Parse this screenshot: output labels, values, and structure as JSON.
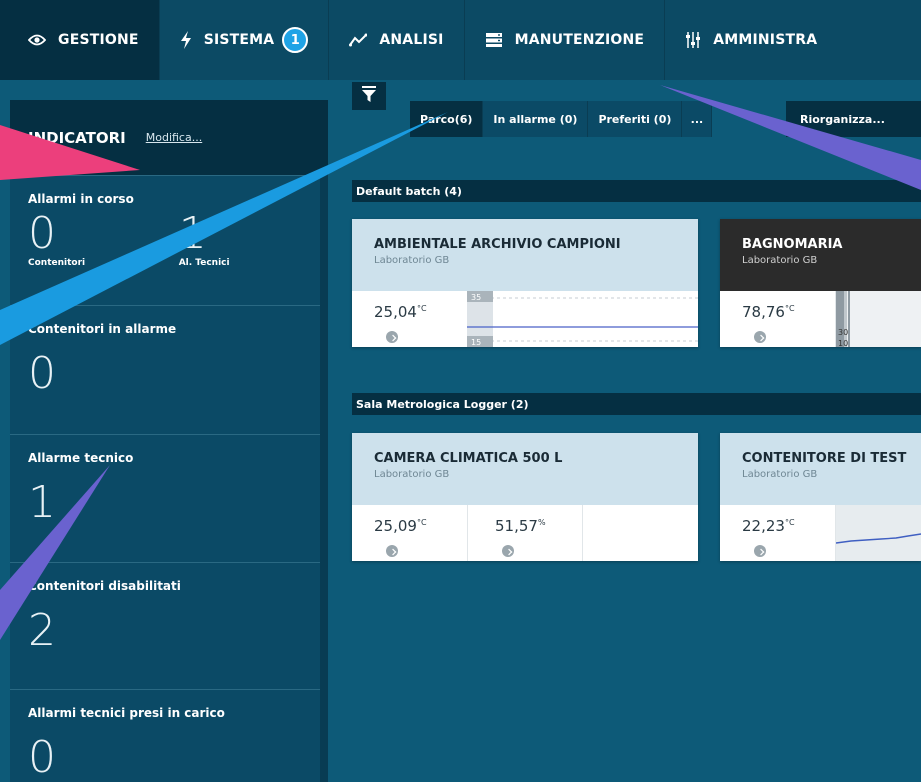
{
  "nav": {
    "items": [
      {
        "label": "GESTIONE",
        "icon": "eye-icon"
      },
      {
        "label": "SISTEMA",
        "icon": "lightning-icon",
        "badge": "1"
      },
      {
        "label": "ANALISI",
        "icon": "trend-line-icon"
      },
      {
        "label": "MANUTENZIONE",
        "icon": "server-icon"
      },
      {
        "label": "AMMINISTRA",
        "icon": "sliders-icon"
      }
    ]
  },
  "sidebar": {
    "title": "INDICATORI",
    "edit_link": "Modifica...",
    "indicators": [
      {
        "label": "Allarmi in corso",
        "values": [
          {
            "value": "0",
            "sub": "Contenitori"
          },
          {
            "value": "1",
            "sub": "Al. Tecnici"
          }
        ]
      },
      {
        "label": "Contenitori in allarme",
        "value": "0"
      },
      {
        "label": "Allarme tecnico",
        "value": "1"
      },
      {
        "label": "Contenitori disabilitati",
        "value": "2"
      },
      {
        "label": "Allarmi tecnici presi in carico",
        "value": "0"
      }
    ]
  },
  "toolbar": {
    "filter_icon": "funnel-icon",
    "tabs": [
      "Parco(6)",
      "In allarme (0)",
      "Preferiti (0)",
      "..."
    ],
    "reorganize": "Riorganizza..."
  },
  "batches": [
    {
      "name": "Default batch (4)",
      "cards": [
        {
          "title": "AMBIENTALE ARCHIVIO CAMPIONI",
          "subtitle": "Laboratorio GB",
          "readings": [
            {
              "value": "25,04",
              "unit": "°C"
            }
          ],
          "chart_max": "35",
          "chart_min": "15"
        },
        {
          "title": "BAGNOMARIA",
          "subtitle": "Laboratorio GB",
          "readings": [
            {
              "value": "78,76",
              "unit": "°C"
            }
          ],
          "chart_mid": "30",
          "chart_min": "10"
        }
      ]
    },
    {
      "name": "Sala Metrologica Logger (2)",
      "cards": [
        {
          "title": "CAMERA CLIMATICA 500 L",
          "subtitle": "Laboratorio GB",
          "readings": [
            {
              "value": "25,09",
              "unit": "°C"
            },
            {
              "value": "51,57",
              "unit": "%"
            }
          ]
        },
        {
          "title": "CONTENITORE DI TEST",
          "subtitle": "Laboratorio GB",
          "readings": [
            {
              "value": "22,23",
              "unit": "°C"
            }
          ]
        }
      ]
    }
  ],
  "colors": {
    "nav_bg": "#0c4a64",
    "nav_active": "#052f42",
    "badge": "#1fa3e6",
    "arrow_pink": "#ec3f7c",
    "arrow_blue": "#1a9be0",
    "arrow_violet": "#6a62cf"
  }
}
